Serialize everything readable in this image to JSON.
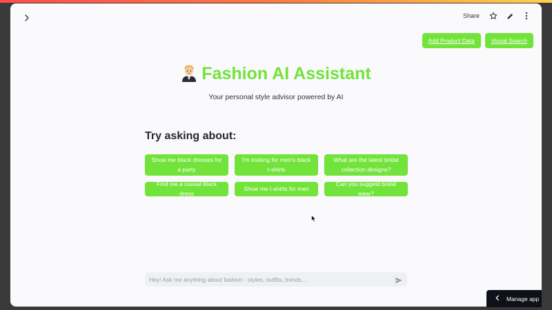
{
  "topbar": {
    "share_label": "Share",
    "icons": [
      "chevron-right-icon",
      "star-icon",
      "pencil-icon",
      "kebab-menu-icon"
    ]
  },
  "header_buttons": {
    "add_product": "Add Product Data",
    "visual_search": "Visual Search"
  },
  "hero": {
    "title": "Fashion AI Assistant",
    "emoji": "man-in-tuxedo-emoji",
    "subtitle": "Your personal style advisor powered by AI"
  },
  "suggestions_section": {
    "heading": "Try asking about:",
    "items": [
      "Show me black dresses for a party",
      "I'm looking for men's black t-shirts",
      "What are the latest bridal collection designs?",
      "Find me a casual black dress",
      "Show me t-shirts for men",
      "Can you suggest bridal wear?"
    ]
  },
  "chat": {
    "placeholder": "Hey! Ask me anything about fashion - styles, outfits, trends...",
    "value": ""
  },
  "footer": {
    "manage_app": "Manage app"
  },
  "colors": {
    "accent_green": "#72e33a",
    "background": "#fafafc",
    "text": "#31333f"
  }
}
